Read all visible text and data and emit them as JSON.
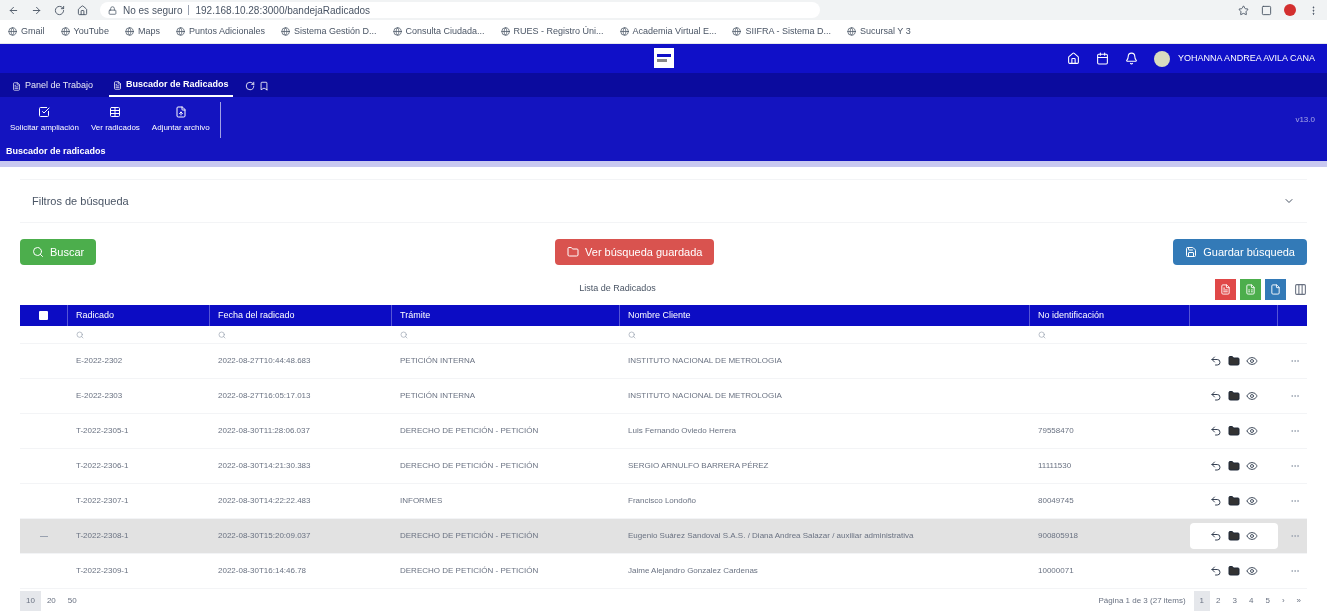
{
  "browser": {
    "security": "No es seguro",
    "url": "192.168.10.28:3000/bandejaRadicados",
    "bookmarks": [
      "Gmail",
      "YouTube",
      "Maps",
      "Puntos Adicionales",
      "Sistema Gestión D...",
      "Consulta Ciudada...",
      "RUES - Registro Úni...",
      "Academia Virtual E...",
      "SIIFRA - Sistema D...",
      "Sucursal Y 3"
    ]
  },
  "header": {
    "user_name": "YOHANNA ANDREA AVILA CANA"
  },
  "tabs": [
    {
      "label": "Panel de Trabajo",
      "selected": false
    },
    {
      "label": "Buscador de Radicados",
      "selected": true
    }
  ],
  "toolbar": {
    "actions": [
      "Solicitar ampliación",
      "Ver radicados",
      "Adjuntar archivo"
    ],
    "version": "v13.0"
  },
  "section_title": "Buscador de radicados",
  "filters": {
    "title": "Filtros de búsqueda",
    "expanded": false
  },
  "buttons": [
    {
      "label": "Buscar",
      "kind": "search"
    },
    {
      "label": "Ver búsqueda guardada",
      "kind": "saved"
    },
    {
      "label": "Guardar búsqueda",
      "kind": "save"
    }
  ],
  "table": {
    "title": "Lista de Radicados",
    "select_all": {
      "checked": false
    },
    "columns": [
      "Radicado",
      "Fecha del radicado",
      "Trámite",
      "Nombre Cliente",
      "No identificación"
    ],
    "rows": [
      {
        "cells": [
          "E-2022-2302",
          "2022-08-27T10:44:48.683",
          "PETICIÓN INTERNA",
          "INSTITUTO NACIONAL DE METROLOGIA",
          ""
        ],
        "selected": false
      },
      {
        "cells": [
          "E-2022-2303",
          "2022-08-27T16:05:17.013",
          "PETICIÓN INTERNA",
          "INSTITUTO NACIONAL DE METROLOGIA",
          ""
        ],
        "selected": false
      },
      {
        "cells": [
          "T-2022-2305-1",
          "2022-08-30T11:28:06.037",
          "DERECHO DE PETICIÓN - PETICIÓN",
          "Luis Fernando Oviedo Herrera",
          "79558470"
        ],
        "selected": false
      },
      {
        "cells": [
          "T-2022-2306-1",
          "2022-08-30T14:21:30.383",
          "DERECHO DE PETICIÓN - PETICIÓN",
          "SERGIO ARNULFO BARRERA PÉREZ",
          "11111530"
        ],
        "selected": false
      },
      {
        "cells": [
          "T-2022-2307-1",
          "2022-08-30T14:22:22.483",
          "INFORMES",
          "Francisco Londoño",
          "80049745"
        ],
        "selected": false
      },
      {
        "cells": [
          "T-2022-2308-1",
          "2022-08-30T15:20:09.037",
          "DERECHO DE PETICIÓN - PETICIÓN",
          "Eugenio Suárez Sandoval S.A.S. / Diana Andrea Salazar / auxiliar administrativa",
          "900805918"
        ],
        "selected": true
      },
      {
        "cells": [
          "T-2022-2309-1",
          "2022-08-30T16:14:46.78",
          "DERECHO DE PETICIÓN - PETICIÓN",
          "Jaime Alejandro Gonzalez Cardenas",
          "10000071"
        ],
        "selected": false
      }
    ]
  },
  "pagination": {
    "page_sizes": [
      {
        "label": "10",
        "selected": true
      },
      {
        "label": "20",
        "selected": false
      },
      {
        "label": "50",
        "selected": false
      }
    ],
    "summary": "Página 1 de 3 (27 items)",
    "pages": [
      {
        "label": "1",
        "selected": true
      },
      {
        "label": "2",
        "selected": false
      },
      {
        "label": "3",
        "selected": false
      },
      {
        "label": "4",
        "selected": false
      },
      {
        "label": "5",
        "selected": false
      }
    ],
    "nav": [
      "›",
      "»"
    ]
  }
}
